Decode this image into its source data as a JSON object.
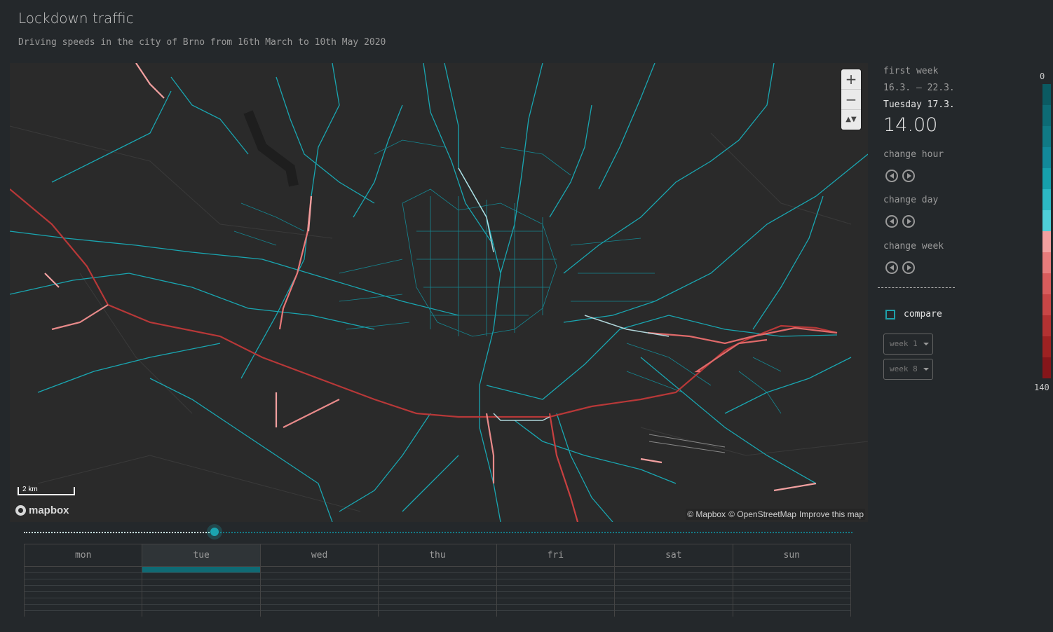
{
  "title": "Lockdown traffic",
  "subtitle": "Driving speeds in the city of Brno from 16th March to 10th May 2020",
  "map": {
    "zoom_in": "+",
    "zoom_out": "−",
    "compass": "▲▼",
    "scale_label": "2 km",
    "logo_text": "mapbox",
    "attribution": [
      "© Mapbox",
      "© OpenStreetMap",
      "Improve this map"
    ]
  },
  "panel": {
    "week_name": "first week",
    "week_range": "16.3. – 22.3.",
    "day_label": "Tuesday 17.3.",
    "hour": "14.00",
    "change_hour": "change hour",
    "change_day": "change day",
    "change_week": "change week",
    "compare_label": "compare",
    "compare_checked": false,
    "week_select_1": "week 1",
    "week_select_2": "week 8"
  },
  "legend": {
    "min_label": "0",
    "max_label": "140",
    "colors": [
      "#0b5a62",
      "#0d6b75",
      "#107a85",
      "#12899a",
      "#16a0ac",
      "#2cb8c4",
      "#4fcfd8",
      "#f2a0a0",
      "#e77c7c",
      "#d85c5c",
      "#c84646",
      "#b33232",
      "#9e2222",
      "#86161a"
    ]
  },
  "timeline": {
    "position": 0.23
  },
  "days": [
    "mon",
    "tue",
    "wed",
    "thu",
    "fri",
    "sat",
    "sun"
  ],
  "active_day": "tue"
}
